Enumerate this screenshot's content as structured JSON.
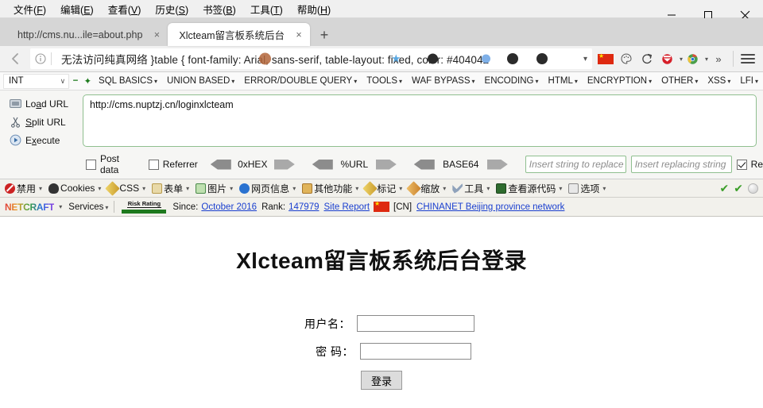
{
  "window": {
    "menu": [
      {
        "label": "文件",
        "accel": "F"
      },
      {
        "label": "编辑",
        "accel": "E"
      },
      {
        "label": "查看",
        "accel": "V"
      },
      {
        "label": "历史",
        "accel": "S"
      },
      {
        "label": "书签",
        "accel": "B"
      },
      {
        "label": "工具",
        "accel": "T"
      },
      {
        "label": "帮助",
        "accel": "H"
      }
    ],
    "controls": {
      "minimize": "minimize-icon",
      "maximize": "maximize-icon",
      "close": "close-icon"
    }
  },
  "tabs": [
    {
      "title": "http://cms.nu...ile=about.php",
      "active": false,
      "close": "×"
    },
    {
      "title": "Xlcteam留言板系统后台",
      "active": true,
      "close": "×"
    }
  ],
  "newtab_label": "+",
  "omnibox": {
    "back_icon": "back-arrow-icon",
    "info_icon": "info-circle-icon",
    "text": "无法访问纯真网络   }table { font-family: Arial, sans-serif, table-layout: fixed, color: #404042",
    "dropdown_caret": "▾",
    "toolbar_icons": [
      {
        "name": "china-flag-icon",
        "label": ""
      },
      {
        "name": "palette-icon",
        "label": ""
      },
      {
        "name": "reload-forward-icon",
        "label": ""
      },
      {
        "name": "hackbar-icon",
        "label": "",
        "caret": "▾"
      },
      {
        "name": "chrome-extension-icon",
        "label": "",
        "caret": "▾"
      },
      {
        "name": "overflow-chevrons-icon",
        "label": "»"
      }
    ],
    "menu_icon": "hamburger-menu-icon"
  },
  "sqlbar": {
    "select_value": "INT",
    "select_caret": "∨",
    "minus": "−",
    "plus": "✦",
    "items": [
      "SQL BASICS",
      "UNION BASED",
      "ERROR/DOUBLE QUERY",
      "TOOLS",
      "WAF BYPASS",
      "ENCODING",
      "HTML",
      "ENCRYPTION",
      "OTHER",
      "XSS",
      "LFI"
    ],
    "caret": "▾"
  },
  "hackbar": {
    "actions": [
      {
        "icon": "load-url-icon",
        "pre": "Lo",
        "accel": "a",
        "post": "d URL"
      },
      {
        "icon": "split-url-icon",
        "pre": "",
        "accel": "S",
        "post": "plit URL"
      },
      {
        "icon": "execute-icon",
        "pre": "E",
        "accel": "x",
        "post": "ecute"
      }
    ],
    "url_value": "http://cms.nuptzj.cn/loginxlcteam",
    "checkboxes": [
      {
        "label": "Post data",
        "checked": false
      },
      {
        "label": "Referrer",
        "checked": false
      }
    ],
    "encoders": [
      {
        "label": "0xHEX"
      },
      {
        "label": "%URL"
      },
      {
        "label": "BASE64"
      }
    ],
    "replace_placeholder": "Insert string to replace",
    "replacing_placeholder": "Insert replacing string",
    "replace_checkbox": {
      "label": "Re",
      "checked": true
    }
  },
  "webdev": {
    "items": [
      {
        "label": "禁用",
        "icon": "disable-icon",
        "color": "#cc2222"
      },
      {
        "label": "Cookies",
        "icon": "cookies-icon",
        "color": "#333333"
      },
      {
        "label": "CSS",
        "icon": "css-pencil-icon",
        "color": "#e8c23a"
      },
      {
        "label": "表单",
        "icon": "forms-clipboard-icon",
        "color": "#d8a23a"
      },
      {
        "label": "图片",
        "icon": "images-icon",
        "color": "#5fa85f"
      },
      {
        "label": "网页信息",
        "icon": "info-blue-icon",
        "color": "#2a72d0"
      },
      {
        "label": "其他功能",
        "icon": "misc-book-icon",
        "color": "#d8a23a"
      },
      {
        "label": "标记",
        "icon": "outline-pencil-icon",
        "color": "#e8c23a"
      },
      {
        "label": "缩放",
        "icon": "resize-ruler-icon",
        "color": "#e8a23a"
      },
      {
        "label": "工具",
        "icon": "tools-wrench-icon",
        "color": "#7a8fae"
      },
      {
        "label": "查看源代码",
        "icon": "view-source-icon",
        "color": "#2e6b2e"
      },
      {
        "label": "选项",
        "icon": "options-icon",
        "color": "#9a9a9a"
      }
    ],
    "caret": "▾",
    "status": [
      {
        "name": "green-check-icon",
        "glyph": "✔"
      },
      {
        "name": "green-check-icon",
        "glyph": "✔"
      },
      {
        "name": "grey-ball-icon",
        "glyph": ""
      }
    ]
  },
  "netcraft": {
    "logo": "NETCRAFT",
    "logo_caret": "▾",
    "services_label": "Services",
    "services_caret": "▾",
    "risk_label": "Risk Rating",
    "since_label": "Since:",
    "since_value": "October 2016",
    "rank_label": "Rank:",
    "rank_value": "147979",
    "site_report": "Site Report",
    "flag_icon": "china-flag-icon",
    "country": "[CN]",
    "network": "CHINANET Beijing province network"
  },
  "page": {
    "title": "Xlcteam留言板系统后台登录",
    "fields": [
      {
        "label": "用户名：",
        "value": "",
        "type": "text",
        "name": "username-input"
      },
      {
        "label": "密 码：",
        "value": "",
        "type": "password",
        "name": "password-input"
      }
    ],
    "submit_label": "登录"
  }
}
